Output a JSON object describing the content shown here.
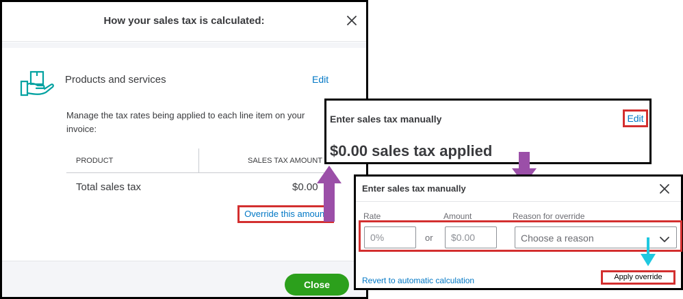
{
  "modal": {
    "title": "How your sales tax is calculated:",
    "section_label": "Products and services",
    "edit_label": "Edit",
    "description": "Manage the tax rates being applied to each line item on your invoice:",
    "table": {
      "col1": "PRODUCT",
      "col2": "SALES TAX AMOUNT"
    },
    "total_label": "Total sales tax",
    "total_value": "$0.00",
    "override_link": "Override this amount",
    "close_button": "Close"
  },
  "summary_panel": {
    "title": "Enter sales tax manually",
    "edit_label": "Edit",
    "amount_text": "$0.00 sales tax applied"
  },
  "manual_panel": {
    "title": "Enter sales tax manually",
    "rate_label": "Rate",
    "amount_label": "Amount",
    "reason_label": "Reason for override",
    "rate_placeholder": "0%",
    "amount_placeholder": "$0.00",
    "or_text": "or",
    "reason_placeholder": "Choose a reason",
    "revert_link": "Revert to automatic calculation",
    "apply_button": "Apply override"
  },
  "colors": {
    "link": "#0077c5",
    "primary_button": "#2ca01c",
    "highlight_box": "#d32f2f",
    "arrow_purple": "#9b4fa8",
    "arrow_cyan": "#1fc8e0"
  },
  "icons": [
    "close-icon",
    "product-hand-box-icon",
    "chevron-down-icon"
  ]
}
